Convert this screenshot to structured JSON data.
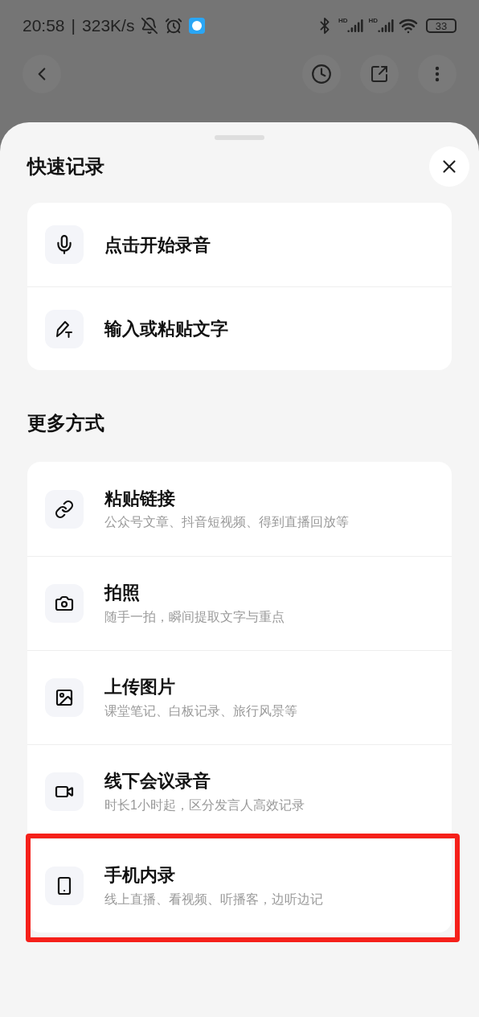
{
  "status_bar": {
    "time": "20:58",
    "separator": "|",
    "speed": "323K/s",
    "signal_labels": [
      "HD",
      "HD"
    ],
    "battery": "33"
  },
  "quick": {
    "title": "快速记录",
    "items": [
      {
        "title": "点击开始录音"
      },
      {
        "title": "输入或粘贴文字"
      }
    ]
  },
  "more": {
    "title": "更多方式",
    "items": [
      {
        "title": "粘贴链接",
        "subtitle": "公众号文章、抖音短视频、得到直播回放等",
        "highlighted": false
      },
      {
        "title": "拍照",
        "subtitle": "随手一拍，瞬间提取文字与重点",
        "highlighted": false
      },
      {
        "title": "上传图片",
        "subtitle": "课堂笔记、白板记录、旅行风景等",
        "highlighted": false
      },
      {
        "title": "线下会议录音",
        "subtitle": "时长1小时起，区分发言人高效记录",
        "highlighted": false
      },
      {
        "title": "手机内录",
        "subtitle": "线上直播、看视频、听播客，边听边记",
        "highlighted": true
      }
    ]
  }
}
